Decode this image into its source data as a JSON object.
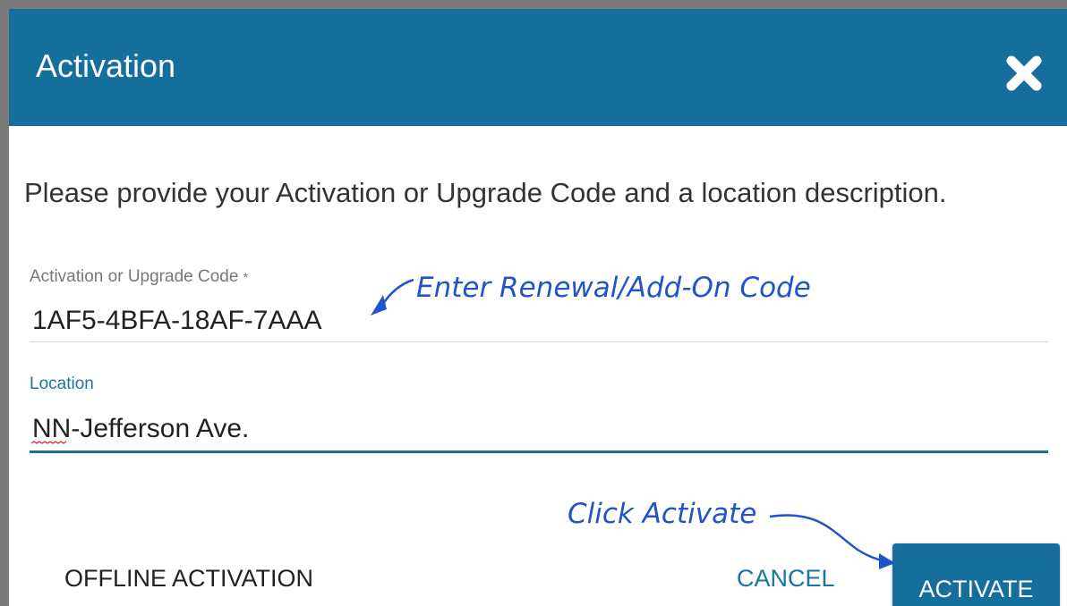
{
  "dialog": {
    "title": "Activation",
    "close_icon": "close-x-icon",
    "instructions": "Please provide your Activation or Upgrade Code and a location description.",
    "code_field": {
      "label": "Activation or Upgrade Code",
      "required_marker": "*",
      "value": "1AF5-4BFA-18AF-7AAA"
    },
    "location_field": {
      "label": "Location",
      "value": "NN-Jefferson Ave."
    },
    "buttons": {
      "offline": "OFFLINE ACTIVATION",
      "cancel": "CANCEL",
      "activate": "ACTIVATE"
    }
  },
  "annotations": {
    "code": "Enter Renewal/Add-On Code",
    "activate": "Click Activate"
  },
  "colors": {
    "header": "#156e9c",
    "accent": "#1a75a6",
    "annotation": "#1f55c8"
  }
}
